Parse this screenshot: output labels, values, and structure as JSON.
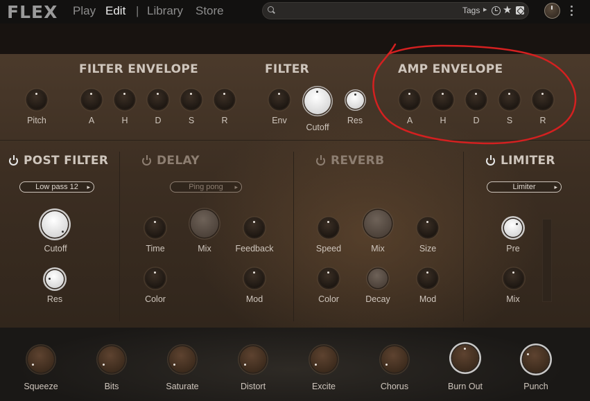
{
  "app": {
    "logo": "FLEX",
    "nav": [
      {
        "label": "Play",
        "active": false
      },
      {
        "label": "Edit",
        "active": true
      },
      {
        "label": "Library",
        "active": false
      },
      {
        "label": "Store",
        "active": false
      }
    ],
    "search_value": "",
    "search_tags_label": "Tags"
  },
  "filter_envelope": {
    "title": "FILTER ENVELOPE",
    "knobs": [
      "Pitch",
      "A",
      "H",
      "D",
      "S",
      "R"
    ]
  },
  "filter": {
    "title": "FILTER",
    "knobs": [
      "Env",
      "Cutoff",
      "Res"
    ]
  },
  "amp_envelope": {
    "title": "AMP ENVELOPE",
    "knobs": [
      "A",
      "H",
      "D",
      "S",
      "R"
    ]
  },
  "post_filter": {
    "title": "POST FILTER",
    "mode": "Low pass 12",
    "knobs": [
      "Cutoff",
      "Res"
    ]
  },
  "delay": {
    "title": "DELAY",
    "mode": "Ping pong",
    "knobs": [
      "Time",
      "Mix",
      "Feedback",
      "Color",
      "Mod"
    ]
  },
  "reverb": {
    "title": "REVERB",
    "knobs": [
      "Speed",
      "Mix",
      "Size",
      "Color",
      "Decay",
      "Mod"
    ]
  },
  "limiter": {
    "title": "LIMITER",
    "mode": "Limiter",
    "knobs": [
      "Pre",
      "Mix"
    ]
  },
  "fx": {
    "knobs": [
      "Squeeze",
      "Bits",
      "Saturate",
      "Distort",
      "Excite",
      "Chorus",
      "Burn Out",
      "Punch"
    ]
  },
  "colors": {
    "annotation": "#d42020",
    "panel_top": "#4b3a2b",
    "panel_bottom": "#31261c",
    "fx_strip": "#1a1816"
  }
}
